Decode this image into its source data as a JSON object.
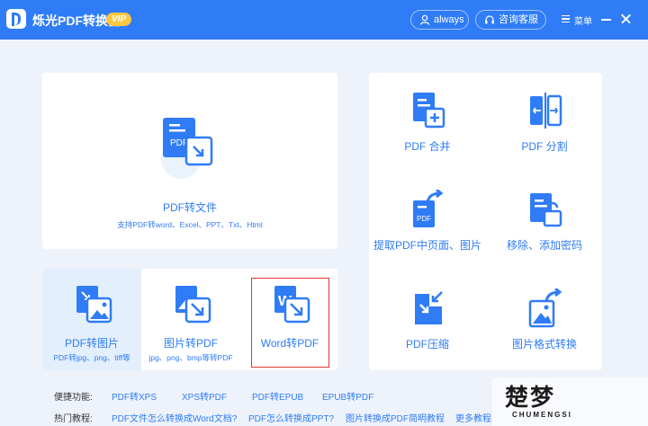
{
  "titlebar": {
    "app_title": "烁光PDF转换器",
    "vip_badge": "VIP",
    "user_label": "always",
    "service_label": "咨询客服",
    "menu_label": "菜单",
    "accent": "#2f7cf6"
  },
  "main_card": {
    "title": "PDF转文件",
    "subtitle": "支持PDF转word、Excel、PPT、Txt、Html",
    "icon_text": "PDF"
  },
  "sub_items": [
    {
      "title": "PDF转图片",
      "subtitle": "PDF转jpg、png、tiff等"
    },
    {
      "title": "图片转PDF",
      "subtitle": "jpg、png、bmp等转PDF"
    },
    {
      "title": "Word转PDF",
      "subtitle": "",
      "icon_text": "W"
    }
  ],
  "tools": [
    {
      "title": "PDF 合并"
    },
    {
      "title": "PDF 分割"
    },
    {
      "title": "提取PDF中页面、图片",
      "icon_text": "PDF"
    },
    {
      "title": "移除、添加密码"
    },
    {
      "title": "PDF压缩"
    },
    {
      "title": "图片格式转换"
    }
  ],
  "footer": {
    "quick_label": "便捷功能:",
    "quick_links": [
      "PDF转XPS",
      "XPS转PDF",
      "PDF转EPUB",
      "EPUB转PDF"
    ],
    "hot_label": "热门教程:",
    "hot_links": [
      "PDF文件怎么转换成Word文档?",
      "PDF怎么转换成PPT?",
      "图片转换成PDF简明教程",
      "更多教程"
    ]
  },
  "watermark": {
    "main": "楚梦",
    "sub": "CHUMENGSI"
  }
}
